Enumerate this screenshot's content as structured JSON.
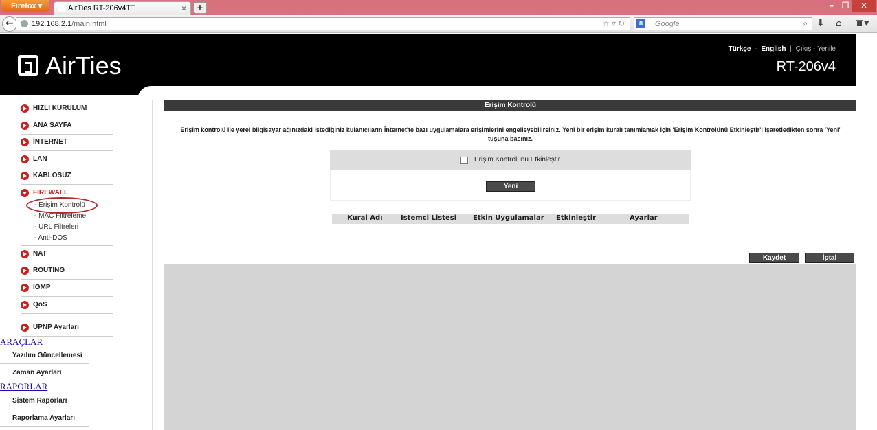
{
  "browser": {
    "firefox_label": "Firefox",
    "tab_title": "AirTies RT-206v4TT",
    "tab_close": "×",
    "new_tab": "+",
    "url_host": "192.168.2.1",
    "url_path": "/main.html",
    "search_placeholder": "Google"
  },
  "header": {
    "logo": "AirTies",
    "lang_tr": "Türkçe",
    "lang_sep": "-",
    "lang_en": "English",
    "divider": "|",
    "logout_restart": "Çıkış - Yenile",
    "model": "RT-206v4"
  },
  "sidebar": {
    "items": [
      {
        "label": "HIZLI KURULUM"
      },
      {
        "label": "ANA SAYFA"
      },
      {
        "label": "İNTERNET"
      },
      {
        "label": "LAN"
      },
      {
        "label": "KABLOSUZ"
      },
      {
        "label": "FIREWALL"
      },
      {
        "label": "NAT"
      },
      {
        "label": "ROUTING"
      },
      {
        "label": "IGMP"
      },
      {
        "label": "QoS"
      },
      {
        "label": "UPNP Ayarları"
      }
    ],
    "firewall_sub": [
      {
        "label": "- Erişim Kontrolü"
      },
      {
        "label": "- MAC Filtreleme"
      },
      {
        "label": "- URL Filtreleri"
      },
      {
        "label": "- Anti-DOS"
      }
    ],
    "tools_heading": "ARAÇLAR",
    "tools": [
      {
        "label": "Yazılım Güncellemesi"
      },
      {
        "label": "Zaman Ayarları"
      }
    ],
    "reports_heading": "RAPORLAR",
    "reports": [
      {
        "label": "Sistem Raporları"
      },
      {
        "label": "Raporlama Ayarları"
      }
    ]
  },
  "main": {
    "title": "Erişim Kontrolü",
    "intro_line1": "Erişim kontrolü ile yerel bilgisayar ağınızdaki istediğiniz kulanıcıların İnternet'te bazı uygulamalara erişimlerini engelleyebilirsiniz. Yeni bir erişim kuralı tanımlamak için 'Erişim Kontrolünü Etkinleştir'i işaretledikten sonra 'Yeni'",
    "intro_line2": "tuşuna basınız.",
    "enable_label": "Erişim Kontrolünü Etkinleştir",
    "enable_checked": false,
    "new_button": "Yeni",
    "columns": [
      "Kural Adı",
      "İstemci Listesi",
      "Etkin Uygulamalar",
      "Etkinleştir",
      "Ayarlar"
    ],
    "save_button": "Kaydet",
    "cancel_button": "İptal"
  }
}
